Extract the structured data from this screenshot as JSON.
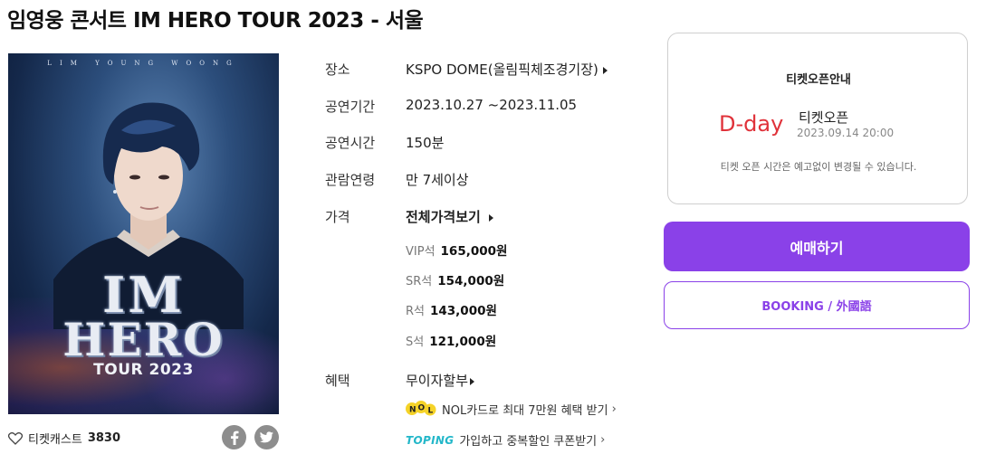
{
  "page": {
    "title": "임영웅 콘서트 IM HERO TOUR 2023 - 서울"
  },
  "poster": {
    "top_text": "LIM YOUNG WOONG",
    "title_line1": "IM",
    "title_line2": "HERO",
    "tour_text": "TOUR 2023"
  },
  "likes": {
    "label": "티켓캐스트",
    "count": "3830",
    "heart_icon": "heart-outline-icon"
  },
  "share": {
    "facebook_icon": "facebook-icon",
    "twitter_icon": "twitter-icon",
    "button_color": "#8d8d8d"
  },
  "info": {
    "venue_label": "장소",
    "venue_value": "KSPO DOME(올림픽체조경기장)",
    "period_label": "공연기간",
    "period_value": "2023.10.27 ~2023.11.05",
    "runtime_label": "공연시간",
    "runtime_value": "150분",
    "age_label": "관람연령",
    "age_value": "만 7세이상",
    "price_label": "가격",
    "price_full_link": "전체가격보기",
    "prices": [
      {
        "name": "VIP석",
        "value": "165,000원"
      },
      {
        "name": "SR석",
        "value": "154,000원"
      },
      {
        "name": "R석",
        "value": "143,000원"
      },
      {
        "name": "S석",
        "value": "121,000원"
      }
    ],
    "benefit_label": "혜택",
    "benefit_value": "무이자할부",
    "nol_text": "NOL카드로 최대 7만원 혜택 받기",
    "toping_logo": "TOPING",
    "toping_text": "가입하고 중복할인 쿠폰받기"
  },
  "ticket_open": {
    "title": "티켓오픈안내",
    "dday": "D-day",
    "label": "티켓오픈",
    "date": "2023.09.14 20:00",
    "note": "티켓 오픈 시간은 예고없이 변경될 수 있습니다."
  },
  "buttons": {
    "reserve": "예매하기",
    "booking": "BOOKING / 外國語"
  },
  "colors": {
    "accent": "#8a41e8",
    "dday": "#e0323a"
  }
}
